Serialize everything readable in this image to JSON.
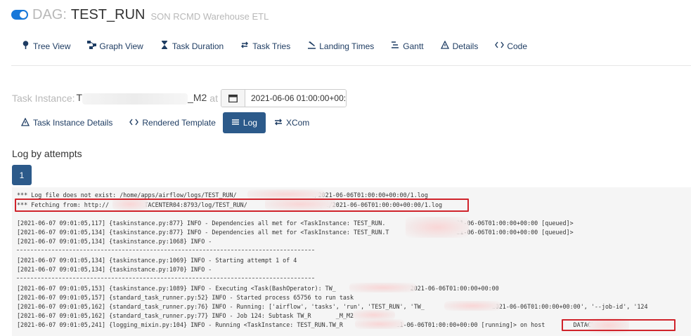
{
  "header": {
    "prefix": "DAG:",
    "dag_id": "TEST_RUN",
    "description": "SON RCMD Warehouse ETL",
    "accent_color": "#1677d9"
  },
  "nav": [
    {
      "label": "Tree View",
      "icon": "tree-icon"
    },
    {
      "label": "Graph View",
      "icon": "graph-icon"
    },
    {
      "label": "Task Duration",
      "icon": "hourglass-icon"
    },
    {
      "label": "Task Tries",
      "icon": "retry-icon"
    },
    {
      "label": "Landing Times",
      "icon": "landing-icon"
    },
    {
      "label": "Gantt",
      "icon": "gantt-icon"
    },
    {
      "label": "Details",
      "icon": "details-icon"
    },
    {
      "label": "Code",
      "icon": "code-icon"
    }
  ],
  "task_instance": {
    "label": "Task Instance:",
    "name_start": "T",
    "name_end": "_M2",
    "at": "at",
    "date_value": "2021-06-06 01:00:00+00:00"
  },
  "subtabs": [
    {
      "label": "Task Instance Details",
      "icon": "warning-icon"
    },
    {
      "label": "Rendered Template",
      "icon": "code-icon"
    },
    {
      "label": "Log",
      "icon": "list-icon",
      "active": true
    },
    {
      "label": "XCom",
      "icon": "exchange-icon"
    }
  ],
  "log": {
    "heading": "Log by attempts",
    "attempt": "1",
    "lines": [
      "*** Log file does not exist: /home/apps/airflow/logs/TEST_RUN/                    M2/2021-06-06T01:00:00+00:00/1.log",
      "*** Fetching from: http://        DATACENTER04:8793/log/TEST_RUN/                    _M2/2021-06-06T01:00:00+00:00/1.log",
      "[2021-06-07 09:01:05,117] {taskinstance.py:877} INFO - Dependencies all met for <TaskInstance: TEST_RUN.              _M2 2021-06-06T01:00:00+00:00 [queued]>",
      "[2021-06-07 09:01:05,134] {taskinstance.py:877} INFO - Dependencies all met for <TaskInstance: TEST_RUN.T             _M2 2021-06-06T01:00:00+00:00 [queued]>",
      "[2021-06-07 09:01:05,134] {taskinstance.py:1068} INFO -",
      "[2021-06-07 09:01:05,134] {taskinstance.py:1069} INFO - Starting attempt 1 of 4",
      "[2021-06-07 09:01:05,134] {taskinstance.py:1070} INFO -",
      "[2021-06-07 09:01:05,153] {taskinstance.py:1089} INFO - Executing <Task(BashOperator): TW_              M2> on 2021-06-06T01:00:00+00:00",
      "[2021-06-07 09:01:05,157] {standard_task_runner.py:52} INFO - Started process 65756 to run task",
      "[2021-06-07 09:01:05,162] {standard_task_runner.py:76} INFO - Running: ['airflow', 'tasks', 'run', 'TEST_RUN', 'TW_            _M2', '2021-06-06T01:00:00+00:00', '--job-id', '124",
      "[2021-06-07 09:01:05,162] {standard_task_runner.py:77} INFO - Job 124: Subtask TW_R       _M_M2",
      "[2021-06-07 09:01:05,241] {logging_mixin.py:104} INFO - Running <TaskInstance: TEST_RUN.TW_R        M_M2 2021-06-06T01:00:00+00:00 [running]> on host        DATACENTER04"
    ],
    "separator": "--------------------------------------------------------------------------------",
    "highlight_color": "#d0232b"
  }
}
